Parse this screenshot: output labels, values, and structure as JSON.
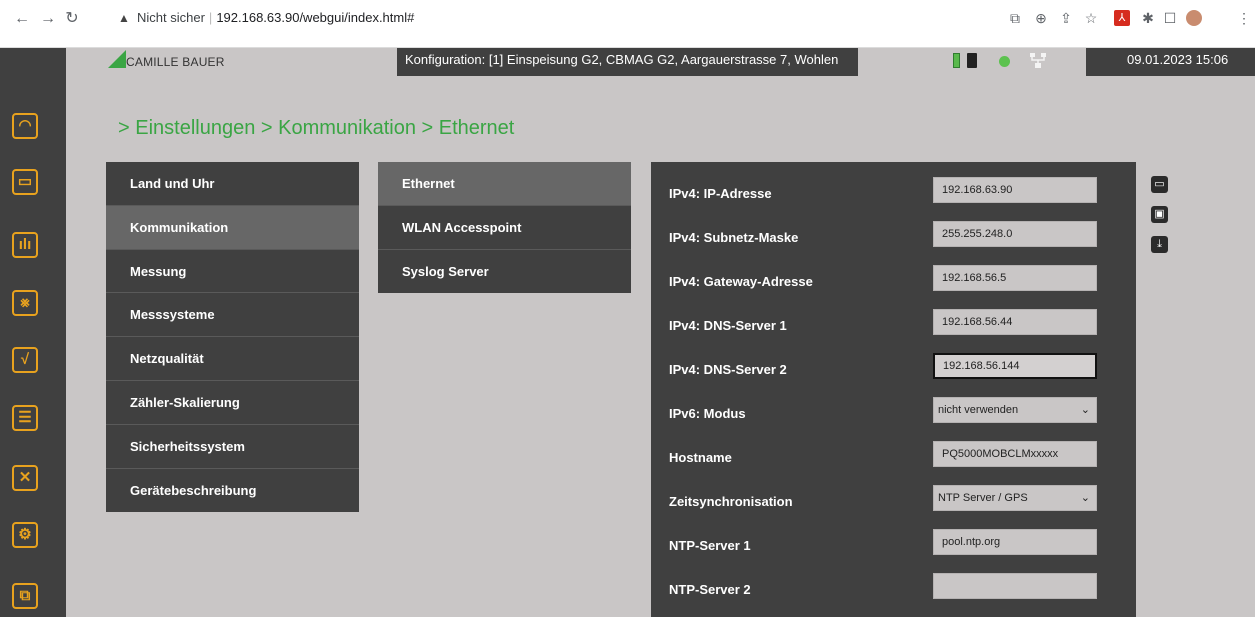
{
  "browser": {
    "security_label": "Nicht sicher",
    "url": "192.168.63.90/webgui/index.html#"
  },
  "header": {
    "logo_text": "CAMILLE BAUER",
    "config": "Konfiguration: [1] Einspeisung G2, CBMAG G2, Aargauerstrasse 7, Wohlen",
    "datetime": "09.01.2023  15:06",
    "status_color": "#5cc24f"
  },
  "breadcrumb": "> Einstellungen > Kommunikation > Ethernet",
  "menu1": [
    {
      "label": "Land und Uhr"
    },
    {
      "label": "Kommunikation"
    },
    {
      "label": "Messung"
    },
    {
      "label": "Messsysteme"
    },
    {
      "label": "Netzqualität"
    },
    {
      "label": "Zähler-Skalierung"
    },
    {
      "label": "Sicherheitssystem"
    },
    {
      "label": "Gerätebeschreibung"
    }
  ],
  "menu2": [
    {
      "label": "Ethernet"
    },
    {
      "label": "WLAN Accesspoint"
    },
    {
      "label": "Syslog Server"
    }
  ],
  "form": {
    "ip_label": "IPv4: IP-Adresse",
    "ip_value": "192.168.63.90",
    "mask_label": "IPv4: Subnetz-Maske",
    "mask_value": "255.255.248.0",
    "gateway_label": "IPv4: Gateway-Adresse",
    "gateway_value": "192.168.56.5",
    "dns1_label": "IPv4: DNS-Server 1",
    "dns1_value": "192.168.56.44",
    "dns2_label": "IPv4: DNS-Server 2",
    "dns2_value": "192.168.56.144",
    "ipv6_label": "IPv6: Modus",
    "ipv6_value": "nicht verwenden",
    "hostname_label": "Hostname",
    "hostname_value": "PQ5000MOBCLMxxxxx",
    "timesync_label": "Zeitsynchronisation",
    "timesync_value": "NTP Server / GPS",
    "ntp1_label": "NTP-Server 1",
    "ntp1_value": "pool.ntp.org",
    "ntp2_label": "NTP-Server 2",
    "ntp2_value": ""
  },
  "colors": {
    "accent_green": "#3aa544",
    "icon_orange": "#e8a21e",
    "panel_dark": "#404040"
  },
  "icons": {
    "sidebar": [
      "dashboard-gauge-icon",
      "meter-icon",
      "bar-chart-icon",
      "waveform-icon",
      "signal-icon",
      "document-list-icon",
      "tools-icon",
      "settings-gear-icon",
      "copy-pages-icon"
    ],
    "tools": [
      "open-folder-icon",
      "save-icon",
      "download-icon"
    ]
  }
}
